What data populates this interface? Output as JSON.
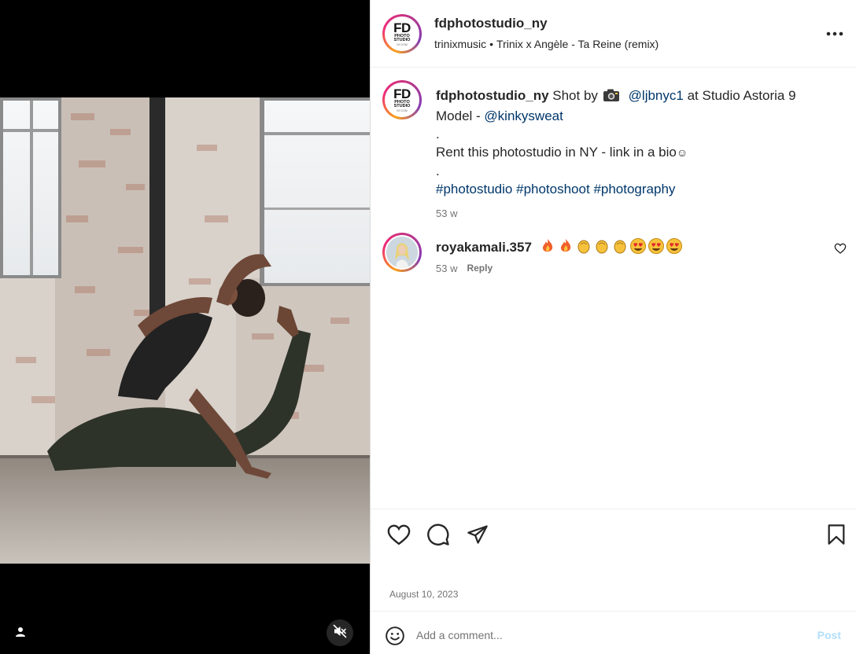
{
  "post": {
    "username": "fdphotostudio_ny",
    "audio_artist": "trinixmusic",
    "audio_separator": "•",
    "audio_track": "Trinix x Angèle - Ta Reine (remix)",
    "avatar_logo": {
      "big": "FD",
      "line1": "PHOTO",
      "line2": "STUDIO",
      "tiny": "NY.COM"
    }
  },
  "caption": {
    "username": "fdphotostudio_ny",
    "shot_by": "Shot by",
    "photographer": "@ljbnyc1",
    "location": "at Studio Astoria 9",
    "model_label": "Model -",
    "model": "@kinkysweat",
    "dot": ".",
    "rent_line": "Rent this photostudio in NY - link in a bio",
    "rent_emoji": "☺",
    "hashtags": [
      "#photostudio",
      "#photoshoot",
      "#photography"
    ],
    "time": "53 w"
  },
  "comment": {
    "username": "royakamali.357",
    "emojis": [
      "fire",
      "fire",
      "clap",
      "clap",
      "clap",
      "heart-eyes",
      "heart-eyes",
      "heart-eyes"
    ],
    "time": "53 w",
    "reply": "Reply"
  },
  "footer": {
    "date": "August 10, 2023",
    "comment_placeholder": "Add a comment...",
    "post_label": "Post"
  },
  "icons": {
    "more": "more-horizontal-icon",
    "like": "heart-icon",
    "comment": "comment-bubble-icon",
    "share": "paper-plane-icon",
    "save": "bookmark-icon",
    "emoji": "smiley-icon",
    "mute": "speaker-muted-icon",
    "tags": "user-tag-icon"
  },
  "colors": {
    "link": "#00376b",
    "muted": "#737373",
    "post_disabled": "#b2dffc",
    "text": "#262626"
  }
}
